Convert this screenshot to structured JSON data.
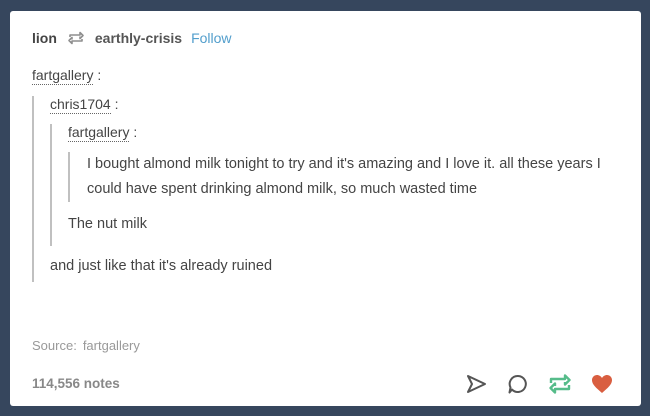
{
  "post": {
    "author": "lion",
    "reblogged_from": "earthly-crisis",
    "follow_label": "Follow",
    "thread": {
      "user1": "fartgallery",
      "user2": "chris1704",
      "user3": "fartgallery",
      "message1": "I bought almond milk tonight to try and it's amazing and I love it. all these years I could have spent drinking almond milk, so much wasted time",
      "message2": "The nut milk",
      "message3": "and just like that it's already ruined",
      "colon": ":"
    },
    "source_label": "Source:",
    "source_value": "fartgallery",
    "notes": "114,556 notes"
  },
  "icons": {
    "reblog": "reblog-icon",
    "share": "share-icon",
    "reply": "reply-icon",
    "reblog_action": "reblog-action-icon",
    "like": "heart-icon"
  },
  "colors": {
    "background": "#36465d",
    "link": "#529ecc",
    "reblog_green": "#56bc8a",
    "like_red": "#d95e40"
  }
}
